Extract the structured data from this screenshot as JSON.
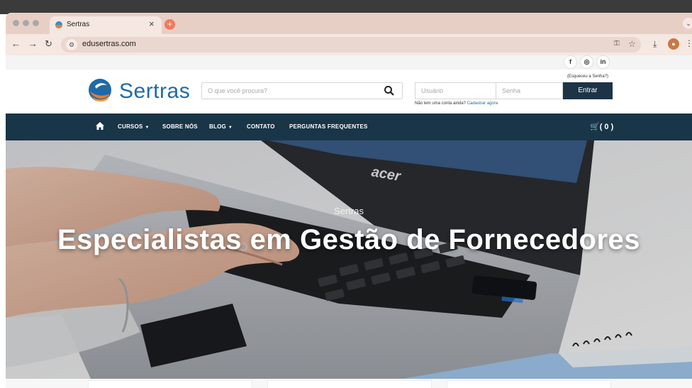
{
  "browser": {
    "tab_title": "Sertras",
    "tab_close": "×",
    "new_tab": "+",
    "url": "edusertras.com",
    "icons": [
      "back-icon",
      "forward-icon",
      "reload-icon",
      "site-info-icon",
      "key-icon",
      "star-icon",
      "download-icon",
      "profile-icon",
      "kebab-icon"
    ]
  },
  "social": {
    "facebook": "f",
    "instagram": "◎",
    "linkedin": "in"
  },
  "header": {
    "logo": "Sertras",
    "search_placeholder": "O que você procura?",
    "forgot": "(Esqueceu a Senha?)",
    "user_placeholder": "Usuário",
    "pass_placeholder": "Senha",
    "login": "Entrar",
    "signup_prefix": "Não tem uma conta ainda?",
    "signup_link": "Cadastrar agora"
  },
  "nav": {
    "items": [
      {
        "label": "CURSOS",
        "has_caret": true
      },
      {
        "label": "SOBRE NÓS",
        "has_caret": false
      },
      {
        "label": "BLOG",
        "has_caret": true
      },
      {
        "label": "CONTATO",
        "has_caret": false
      },
      {
        "label": "PERGUNTAS FREQUENTES",
        "has_caret": false
      }
    ],
    "caret": "▼",
    "cart": "( 0 )"
  },
  "hero": {
    "kicker": "Sertras",
    "title": "Especialistas em Gestão de Fornecedores",
    "laptop_brand": "acer"
  },
  "colors": {
    "navbar": "#193548",
    "login_button": "#1d3446",
    "logo_blue": "#1f6aa6",
    "logo_orange": "#f07a2c",
    "tab_strip": "#e8cfc5"
  }
}
